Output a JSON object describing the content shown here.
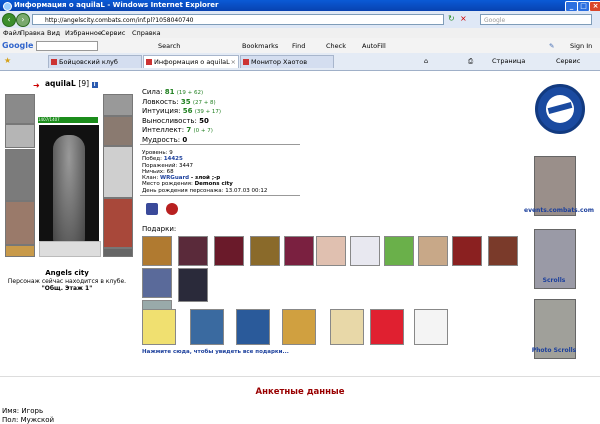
{
  "window": {
    "title": "Информация о aquilaL - Windows Internet Explorer"
  },
  "address": {
    "url": "http://angelscity.combats.com/inf.pl?1058040740",
    "search_placeholder": "Google"
  },
  "menu": [
    "Файл",
    "Правка",
    "Вид",
    "Избранное",
    "Сервис",
    "Справка"
  ],
  "google_toolbar": {
    "brand": "Google",
    "search_label": "Search",
    "bookmarks_label": "Bookmarks",
    "find_label": "Find",
    "check_label": "Check",
    "autofill_label": "AutoFill",
    "signin_label": "Sign In"
  },
  "tabs": [
    {
      "label": "Бойцовский клуб",
      "active": false
    },
    {
      "label": "Информация о aquilaL",
      "active": true
    },
    {
      "label": "Монитор Хаотов",
      "active": false
    }
  ],
  "tab_toolbar": {
    "page_label": "Страница",
    "tools_label": "Сервис"
  },
  "character": {
    "nick": "aquilaL",
    "level": "[9]",
    "hp": "1407/1407",
    "city": "Angels city",
    "location_note": "Персонаж сейчас находится в клубе.",
    "location_room": "\"Общ. Этаж 1\""
  },
  "stats": [
    {
      "label": "Сила:",
      "value": "81",
      "bonus": "(19 + 62)"
    },
    {
      "label": "Ловкость:",
      "value": "35",
      "bonus": "(27 + 8)"
    },
    {
      "label": "Интуиция:",
      "value": "56",
      "bonus": "(39 + 17)"
    },
    {
      "label": "Выносливость:",
      "value": "50",
      "bonus": ""
    },
    {
      "label": "Интеллект:",
      "value": "7",
      "bonus": "(0 + 7)"
    },
    {
      "label": "Мудрость:",
      "value": "0",
      "bonus": ""
    }
  ],
  "info": {
    "level": "Уровень: 9",
    "wins_label": "Побед:",
    "wins": "14425",
    "losses": "Поражений: 3447",
    "draws": "Ничьих: 68",
    "clan_label": "Клан:",
    "clan": "WRGuard",
    "clan_note": "- злой ;-p",
    "birthplace_label": "Место рождения:",
    "birthplace": "Demons city",
    "birthday": "День рождения персонажа: 13.07.03 00:12"
  },
  "gifts": {
    "label": "Подарки:",
    "link": "Нажмите сюда, чтобы увидеть все подарки..."
  },
  "right_panel": {
    "events_link": "events.combats.com",
    "scrolls_link": "Scrolls",
    "photo_link": "Photo Scrolls"
  },
  "anketa": {
    "title": "Анкетные данные",
    "name_label": "Имя:",
    "name": "Игорь",
    "sex_label": "Пол:",
    "sex": "Мужской"
  },
  "colors": {
    "titlebar": "#0a5ad6",
    "stat_value": "#1f7f1f",
    "link": "#1b3f9c",
    "heading": "#990000"
  }
}
